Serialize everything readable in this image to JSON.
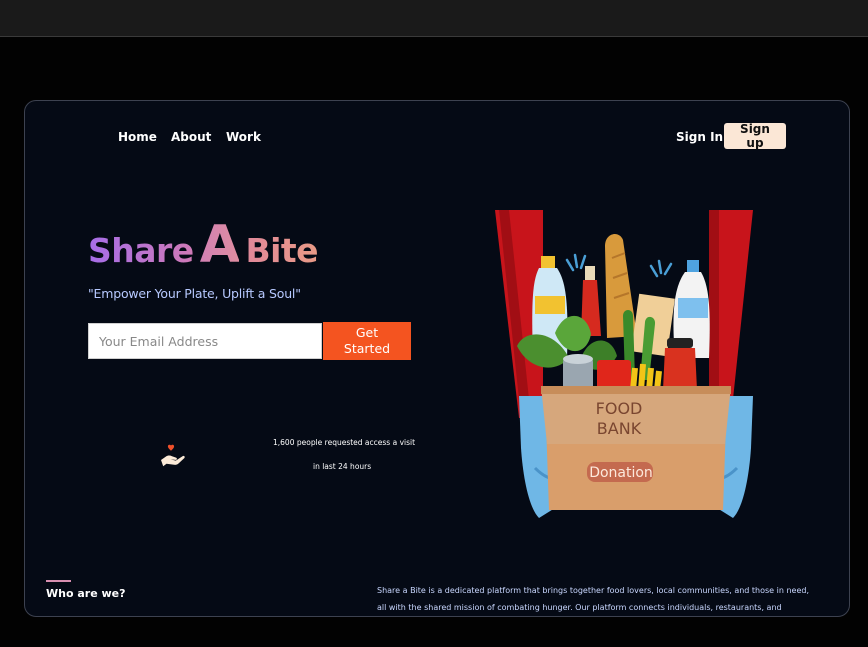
{
  "nav": {
    "links": [
      "Home",
      "About",
      "Work"
    ],
    "sign_in": "Sign In",
    "sign_up": "Sign up"
  },
  "hero": {
    "brand": {
      "part1": "Share",
      "part2": "A",
      "part3": "Bite"
    },
    "tagline": "\"Empower Your Plate, Uplift a Soul\"",
    "email_placeholder": "Your Email Address",
    "cta": "Get Started",
    "stat_line1": "1,600 people requested access a visit",
    "stat_line2": "in last 24 hours"
  },
  "illustration": {
    "box_title_line1": "FOOD",
    "box_title_line2": "BANK",
    "box_label": "Donation"
  },
  "about": {
    "heading": "Who are we?",
    "text_line1": "Share a Bite is a dedicated platform that brings together food lovers, local communities, and those in need,",
    "text_line2": "all with the shared mission of combating hunger. Our platform connects individuals, restaurants, and"
  },
  "colors": {
    "accent": "#f45420",
    "signup_bg": "#fbe7d6",
    "brand_gradient_start": "#a66de8",
    "brand_gradient_end": "#e99a86",
    "tagline": "#b7c9ff",
    "page_bg": "#050a15"
  },
  "icons": [
    "hand-heart-icon"
  ]
}
